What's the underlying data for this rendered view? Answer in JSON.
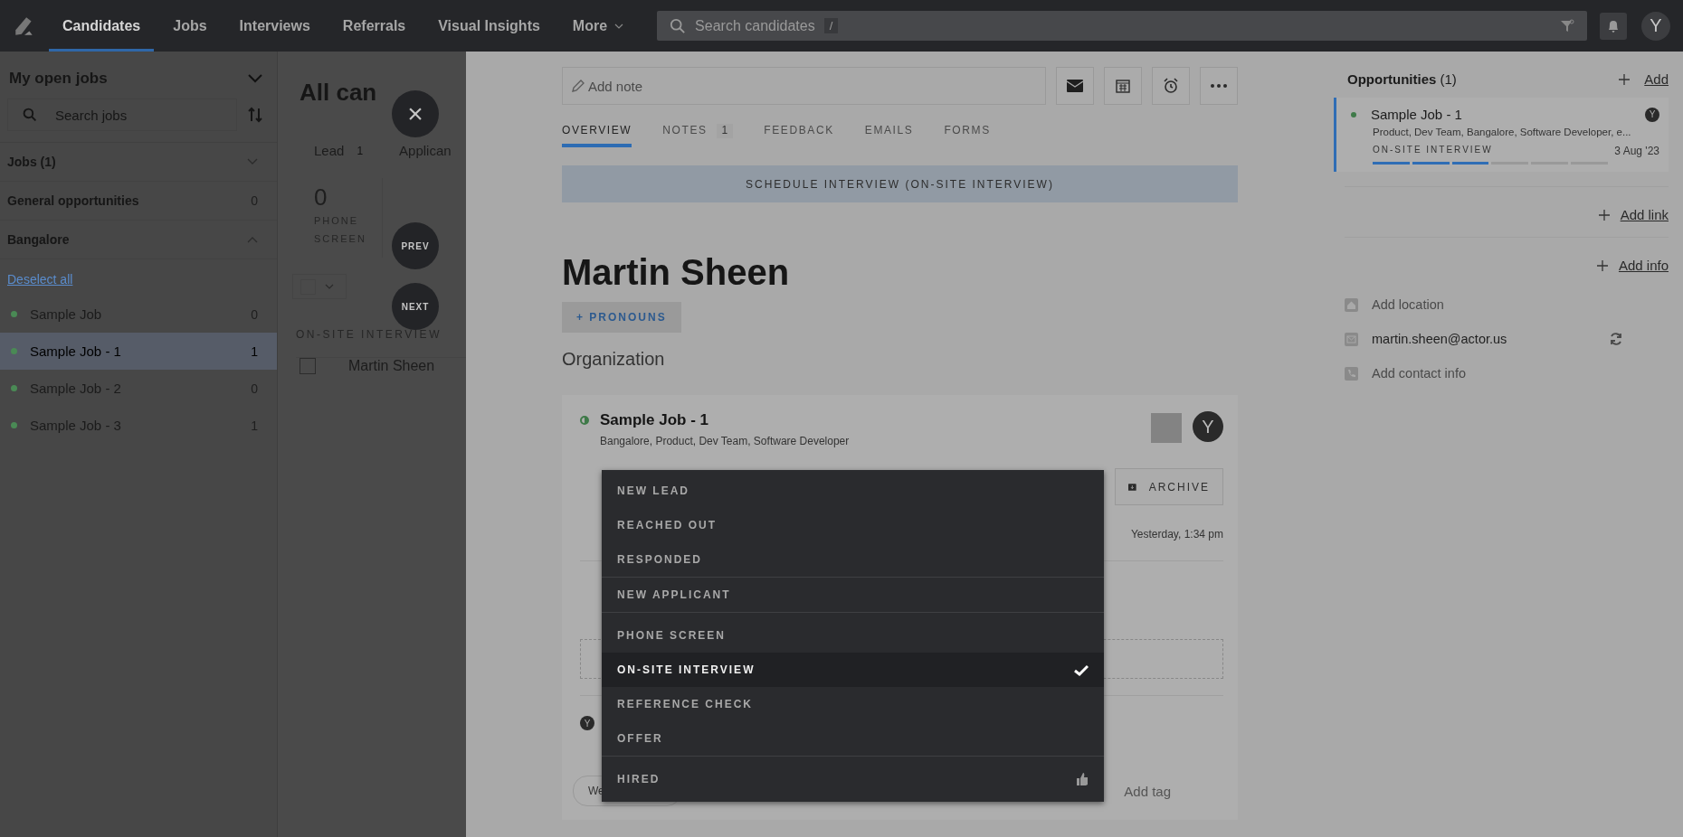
{
  "topbar": {
    "nav": [
      {
        "label": "Candidates",
        "selected": true
      },
      {
        "label": "Jobs",
        "selected": false
      },
      {
        "label": "Interviews",
        "selected": false
      },
      {
        "label": "Referrals",
        "selected": false
      },
      {
        "label": "Visual Insights",
        "selected": false
      }
    ],
    "more": "More",
    "search": {
      "placeholder": "Search candidates",
      "shortcut": "/"
    },
    "avatar": "Y"
  },
  "sidebar": {
    "title": "My open jobs",
    "search": {
      "placeholder": "Search jobs"
    },
    "sections": [
      {
        "label": "Jobs (1)",
        "expanded": false
      },
      {
        "label": "General opportunities",
        "count": "0"
      },
      {
        "label": "Bangalore",
        "expanded": true
      }
    ],
    "deselect": "Deselect all",
    "jobs": [
      {
        "name": "Sample Job",
        "count": "0",
        "selected": false,
        "color": "#4a8a55"
      },
      {
        "name": "Sample Job - 1",
        "count": "1",
        "selected": true,
        "color": "#4a8a55"
      },
      {
        "name": "Sample Job - 2",
        "count": "0",
        "selected": false,
        "color": "#4a8a55"
      },
      {
        "name": "Sample Job - 3",
        "count": "1",
        "selected": false,
        "color": "#4a8a55"
      }
    ]
  },
  "list": {
    "title": "All can",
    "groups": [
      {
        "label": "Lead",
        "count": "1"
      },
      {
        "label": "Applican"
      }
    ],
    "stages": [
      {
        "count": "0",
        "label": "PHONE SCREEN"
      }
    ],
    "stage_heading": "ON-SITE INTERVIEW",
    "rows": [
      {
        "name": "Martin Sheen",
        "checked": false
      }
    ],
    "buttons": {
      "close": "×",
      "prev": "PREV",
      "next": "NEXT"
    }
  },
  "profile": {
    "note": {
      "placeholder": "Add note"
    },
    "tabs": [
      {
        "label": "OVERVIEW",
        "selected": true
      },
      {
        "label": "NOTES",
        "badge": "1",
        "selected": false
      },
      {
        "label": "FEEDBACK",
        "selected": false
      },
      {
        "label": "EMAILS",
        "selected": false
      },
      {
        "label": "FORMS",
        "selected": false
      }
    ],
    "banner": "SCHEDULE INTERVIEW (ON-SITE INTERVIEW)",
    "name": "Martin Sheen",
    "pronouns": "+ PRONOUNS",
    "organization": "Organization",
    "job": {
      "title": "Sample Job - 1",
      "details": "Bangalore, Product, Dev Team, Software Developer",
      "owner": "Y",
      "archive": "ARCHIVE",
      "time": "Yesterday, 1:34 pm",
      "activity_avatar": "Y",
      "tag_field": "We",
      "add_tag": "Add tag"
    },
    "stage_menu": [
      [
        {
          "label": "NEW LEAD",
          "kind": "stage",
          "selected": false
        },
        {
          "label": "REACHED OUT",
          "kind": "stage",
          "selected": false
        },
        {
          "label": "RESPONDED",
          "kind": "stage",
          "selected": false
        }
      ],
      [
        {
          "label": "NEW APPLICANT",
          "kind": "stage",
          "selected": false
        }
      ],
      [
        {
          "label": "PHONE SCREEN",
          "kind": "stage",
          "selected": false
        },
        {
          "label": "ON-SITE INTERVIEW",
          "kind": "stage",
          "selected": true
        },
        {
          "label": "REFERENCE CHECK",
          "kind": "stage",
          "selected": false
        },
        {
          "label": "OFFER",
          "kind": "stage",
          "selected": false
        }
      ],
      [
        {
          "label": "HIRED",
          "kind": "hired",
          "selected": false
        }
      ]
    ]
  },
  "side": {
    "opportunities": {
      "title": "Opportunities",
      "count": "(1)",
      "add": "Add"
    },
    "opportunity": {
      "title": "Sample Job - 1",
      "details": "Product, Dev Team, Bangalore, Software Developer, e...",
      "stage": "ON-SITE INTERVIEW",
      "date": "3 Aug '23",
      "owner": "Y",
      "level": 0.5
    },
    "add_link": "Add link",
    "add_info": "Add info",
    "contacts": [
      {
        "kind": "location",
        "text": "Add location",
        "placeholder": true
      },
      {
        "kind": "email",
        "text": "martin.sheen@actor.us",
        "placeholder": false
      },
      {
        "kind": "phone",
        "text": "Add contact info",
        "placeholder": true
      }
    ]
  }
}
